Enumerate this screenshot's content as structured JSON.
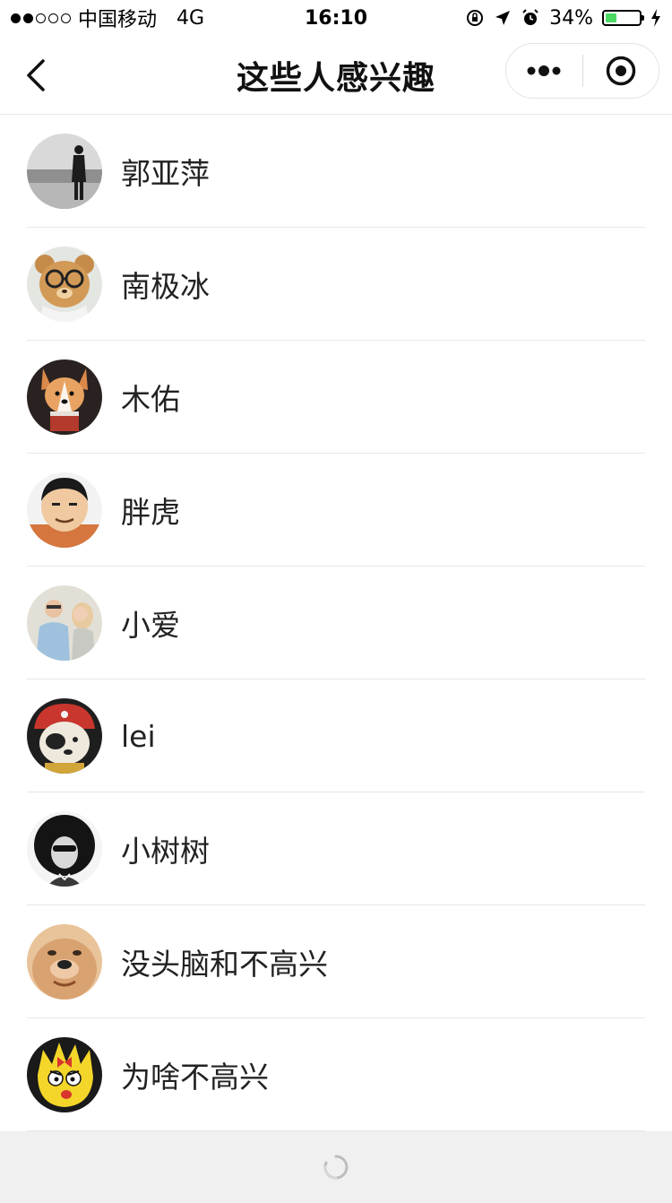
{
  "status_bar": {
    "carrier": "中国移动",
    "network": "4G",
    "time": "16:10",
    "battery": "34%",
    "battery_level": 0.34,
    "battery_color": "#4cd964"
  },
  "nav": {
    "title": "这些人感兴趣",
    "back_icon": "chevron-left-icon",
    "more_icon": "more-dots-icon",
    "close_icon": "target-circle-icon"
  },
  "users": [
    {
      "name": "郭亚萍"
    },
    {
      "name": "南极冰"
    },
    {
      "name": "木佑"
    },
    {
      "name": "胖虎"
    },
    {
      "name": "小爱"
    },
    {
      "name": "lei"
    },
    {
      "name": "小树树"
    },
    {
      "name": "没头脑和不高兴"
    },
    {
      "name": "为啥不高兴"
    }
  ],
  "footer": {
    "loading_icon": "loading-spinner-icon"
  }
}
